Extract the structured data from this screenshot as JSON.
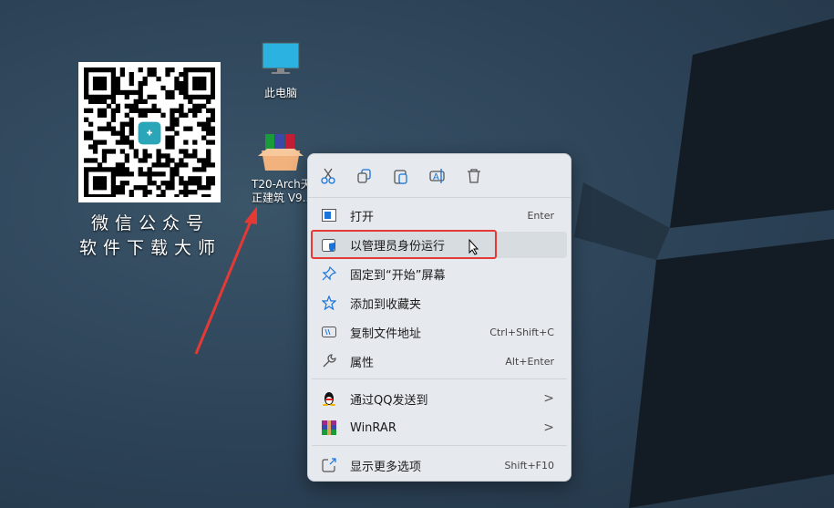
{
  "desktop": {
    "qr_caption": [
      "微信公众号",
      "软件下载大师"
    ],
    "icons": [
      {
        "label": "此电脑"
      },
      {
        "label_lines": [
          "T20-Arch天",
          "正建筑 V9.."
        ]
      }
    ]
  },
  "context_menu": {
    "toolbar": [
      "cut-icon",
      "copy-icon",
      "paste-icon",
      "rename-icon",
      "delete-icon"
    ],
    "items": [
      {
        "label": "打开",
        "shortcut": "Enter"
      },
      {
        "label": "以管理员身份运行",
        "shortcut": ""
      },
      {
        "label": "固定到“开始”屏幕",
        "shortcut": ""
      },
      {
        "label": "添加到收藏夹",
        "shortcut": ""
      },
      {
        "label": "复制文件地址",
        "shortcut": "Ctrl+Shift+C"
      },
      {
        "label": "属性",
        "shortcut": "Alt+Enter"
      },
      {
        "label": "通过QQ发送到",
        "submenu": ">"
      },
      {
        "label": "WinRAR",
        "submenu": ">"
      },
      {
        "label": "显示更多选项",
        "shortcut": "Shift+F10"
      }
    ]
  },
  "colors": {
    "highlight_border": "#e53935",
    "accent": "#1a73d9"
  }
}
